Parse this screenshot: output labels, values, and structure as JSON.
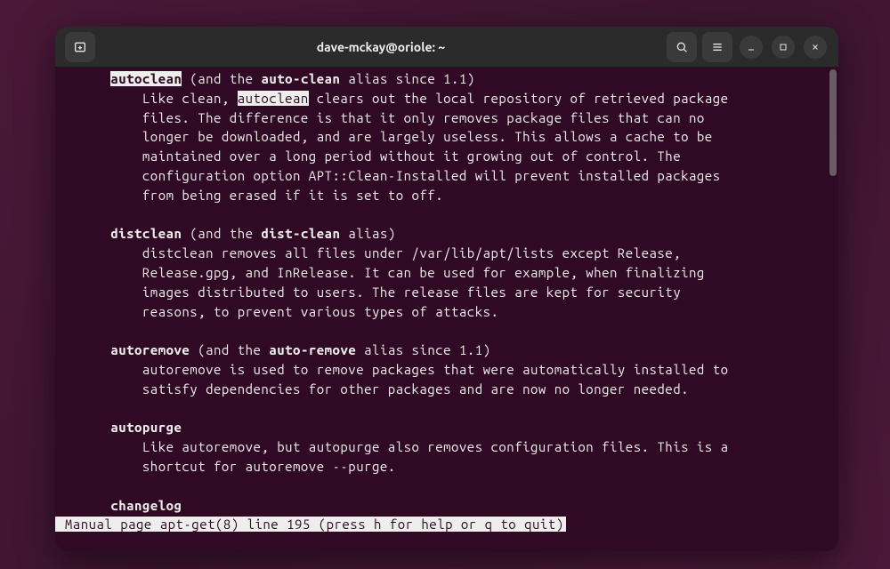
{
  "window": {
    "title": "dave-mckay@oriole: ~"
  },
  "man": {
    "autoclean_cmd": "autoclean",
    "autoclean_alias_pre": " (and the ",
    "autoclean_alias_bold": "auto-clean",
    "autoclean_alias_post": " alias since 1.1)",
    "autoclean_line1_pre": "Like clean, ",
    "autoclean_line1_hl": "autoclean",
    "autoclean_line1_post": " clears out the local repository of retrieved package",
    "autoclean_line2": "files. The difference is that it only removes package files that can no",
    "autoclean_line3": "longer be downloaded, and are largely useless. This allows a cache to be",
    "autoclean_line4": "maintained over a long period without it growing out of control. The",
    "autoclean_line5": "configuration option APT::Clean-Installed will prevent installed packages",
    "autoclean_line6": "from being erased if it is set to off.",
    "distclean_cmd": "distclean",
    "distclean_alias_pre": " (and the ",
    "distclean_alias_bold": "dist-clean",
    "distclean_alias_post": " alias)",
    "distclean_line1": "distclean removes all files under /var/lib/apt/lists except Release,",
    "distclean_line2": "Release.gpg, and InRelease. It can be used for example, when finalizing",
    "distclean_line3": "images distributed to users. The release files are kept for security",
    "distclean_line4": "reasons, to prevent various types of attacks.",
    "autoremove_cmd": "autoremove",
    "autoremove_alias_pre": " (and the ",
    "autoremove_alias_bold": "auto-remove",
    "autoremove_alias_post": " alias since 1.1)",
    "autoremove_line1": "autoremove is used to remove packages that were automatically installed to",
    "autoremove_line2": "satisfy dependencies for other packages and are now no longer needed.",
    "autopurge_cmd": "autopurge",
    "autopurge_line1": "Like autoremove, but autopurge also removes configuration files. This is a",
    "autopurge_line2": "shortcut for autoremove --purge.",
    "changelog_cmd": "changelog",
    "status": " Manual page apt-get(8) line 195 (press h for help or q to quit)"
  },
  "indent": {
    "cmd": "       ",
    "body": "           "
  }
}
